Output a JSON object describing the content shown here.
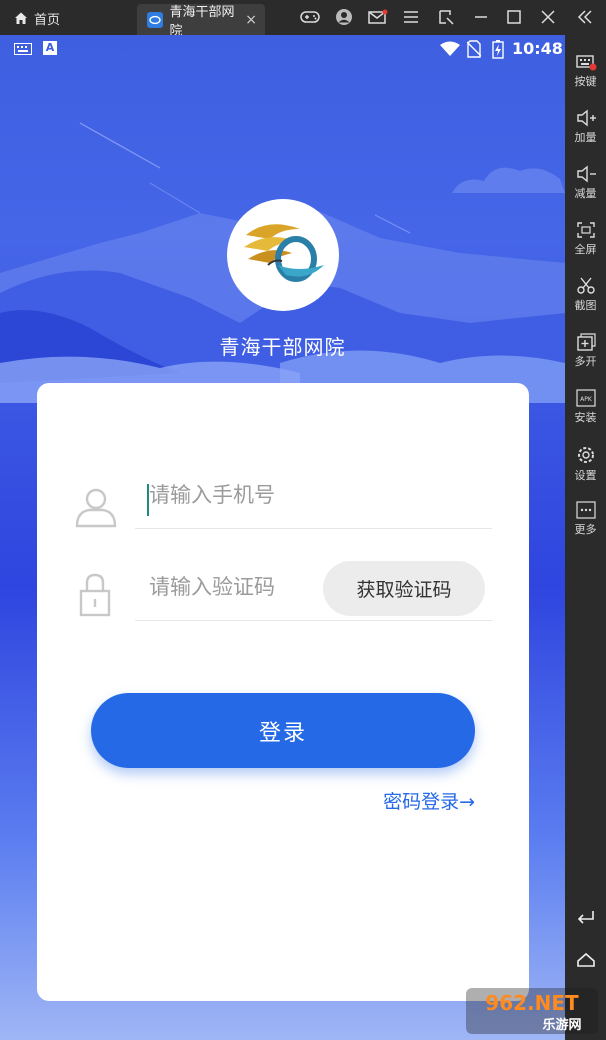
{
  "emulator": {
    "home_tab_label": "首页",
    "app_tab_label": "青海干部网院",
    "tab_close": "×",
    "sidebar": [
      {
        "label": "按键",
        "icon": "keyboard-icon"
      },
      {
        "label": "加量",
        "icon": "volume-up-icon"
      },
      {
        "label": "减量",
        "icon": "volume-down-icon"
      },
      {
        "label": "全屏",
        "icon": "fullscreen-icon"
      },
      {
        "label": "截图",
        "icon": "scissors-icon"
      },
      {
        "label": "多开",
        "icon": "multi-open-icon"
      },
      {
        "label": "安装",
        "icon": "apk-install-icon"
      },
      {
        "label": "设置",
        "icon": "settings-icon"
      },
      {
        "label": "更多",
        "icon": "more-icon"
      }
    ]
  },
  "statusbar": {
    "time": "10:48",
    "notify_letter": "A"
  },
  "app": {
    "title": "青海干部网院",
    "phone_placeholder": "请输入手机号",
    "code_placeholder": "请输入验证码",
    "get_code_label": "获取验证码",
    "login_label": "登录",
    "password_login_label": "密码登录→"
  },
  "watermark": {
    "brand_top": "962.NET",
    "brand_bottom": "乐游网"
  },
  "colors": {
    "primary": "#2569e6",
    "card_bg": "#ffffff",
    "sky_top": "#3d5fe0",
    "sky_bottom": "#9fb6f5"
  }
}
